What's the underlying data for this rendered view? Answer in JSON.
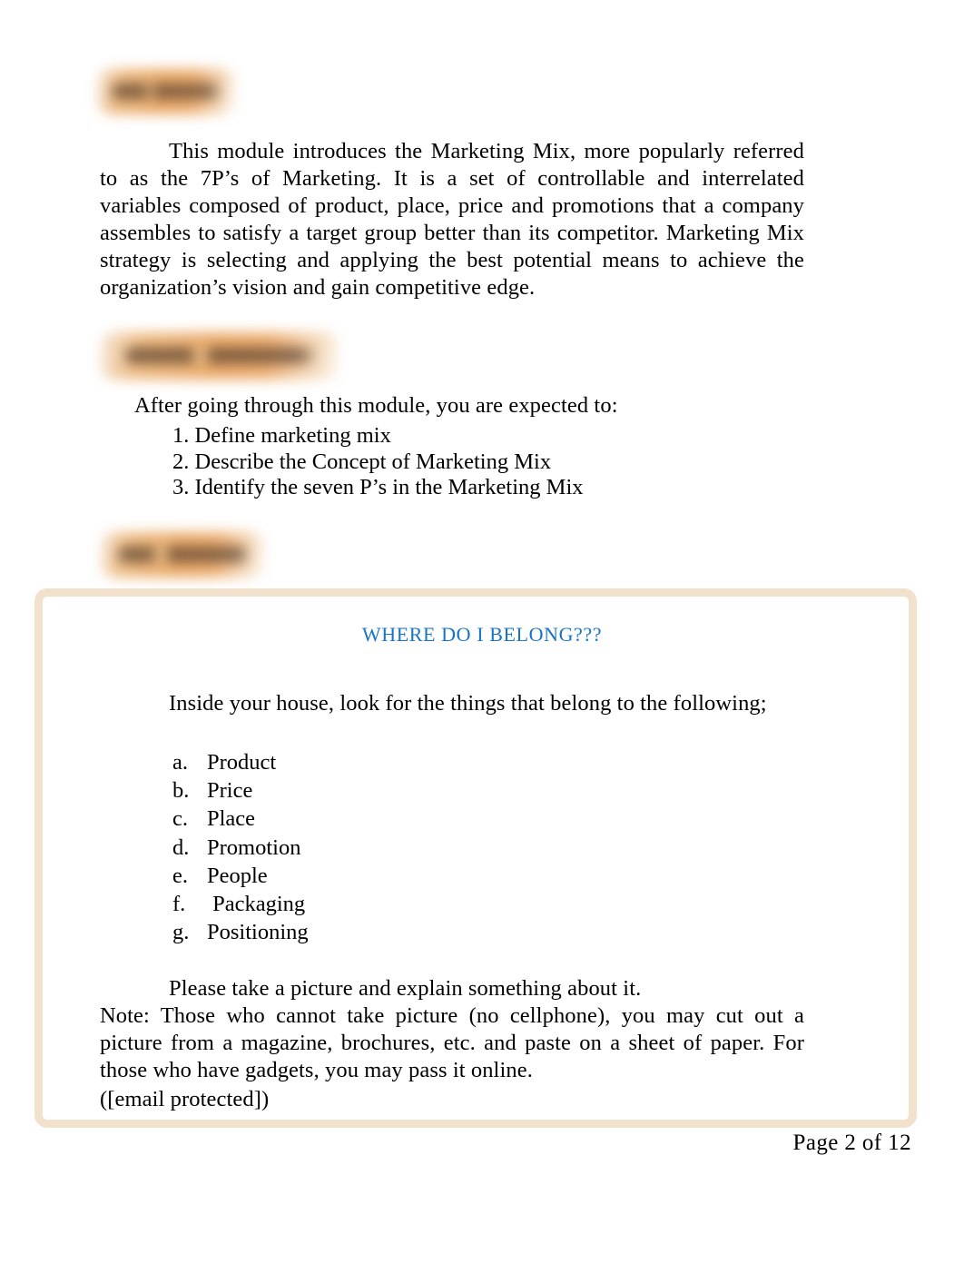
{
  "document": {
    "page_background": "#ffffff",
    "accent_blue": "#1974c7",
    "banner_orange": "#e9a55f",
    "box_border": "#f2e1cd"
  },
  "sections": {
    "overview": {
      "heading_label": "Overview",
      "heading_state": "blurred",
      "paragraph": "This module introduces the Marketing Mix, more popularly referred to as the 7P’s of Marketing. It is a set of controllable and interrelated variables composed of product, place, price and promotions that a company assembles to satisfy a target group better than its competitor. Marketing Mix strategy is selecting and applying the best potential means to achieve the organization’s vision and gain competitive edge."
    },
    "targets": {
      "heading_label": "Your Targets",
      "heading_state": "blurred",
      "lead": "After going through this module, you are expected to:",
      "objectives": [
        "1. Define marketing mix",
        "2. Describe the Concept of Marketing Mix",
        "3. Identify the seven P’s in the Marketing Mix"
      ]
    },
    "try_this": {
      "heading_label": "Try This",
      "heading_state": "blurred"
    }
  },
  "activity": {
    "title": "WHERE DO I BELONG???",
    "intro": "Inside your house, look for the things that belong to the following;",
    "items": [
      {
        "marker": "a.",
        "label": "Product"
      },
      {
        "marker": "b.",
        "label": "Price"
      },
      {
        "marker": "c.",
        "label": "Place"
      },
      {
        "marker": "d.",
        "label": "Promotion"
      },
      {
        "marker": "e.",
        "label": "People"
      },
      {
        "marker": "f.",
        "label": " Packaging"
      },
      {
        "marker": "g.",
        "label": "Positioning"
      }
    ],
    "instruction": "Please take a picture and explain something about it.",
    "note": "Note:  Those who cannot take picture (no cellphone), you may cut out a picture from a magazine, brochures, etc. and paste on a sheet of paper. For those who have gadgets, you may pass it online.",
    "email": "([email protected])"
  },
  "footer": {
    "page_label": "Page  2 of 12"
  }
}
